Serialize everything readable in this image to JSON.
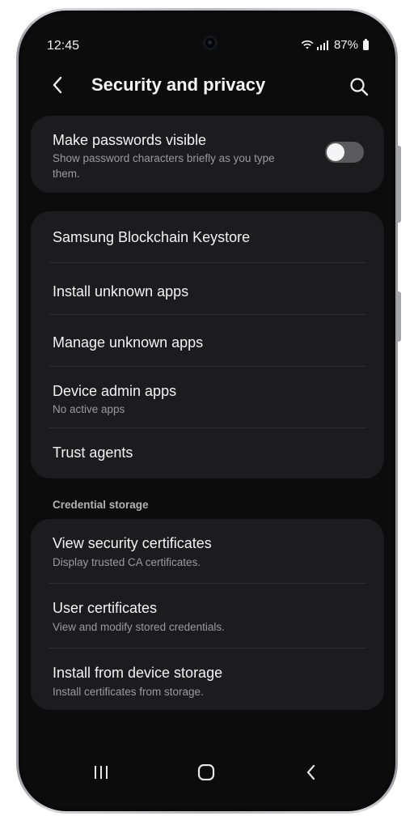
{
  "status_bar": {
    "time": "12:45",
    "battery": "87%",
    "icons": [
      "wifi-icon",
      "signal-icon",
      "battery-icon"
    ]
  },
  "header": {
    "back_icon": "chevron-left-icon",
    "title": "Security and privacy",
    "search_icon": "search-icon"
  },
  "password_card": {
    "title": "Make passwords visible",
    "subtitle": "Show password characters briefly as you type them.",
    "toggle_on": false
  },
  "apps_card": {
    "items": [
      {
        "title": "Samsung Blockchain Keystore",
        "subtitle": ""
      },
      {
        "title": "Install unknown apps",
        "subtitle": ""
      },
      {
        "title": "Manage unknown apps",
        "subtitle": ""
      },
      {
        "title": "Device admin apps",
        "subtitle": "No active apps"
      },
      {
        "title": "Trust agents",
        "subtitle": ""
      }
    ]
  },
  "credential_section": {
    "header": "Credential storage",
    "items": [
      {
        "title": "View security certificates",
        "subtitle": "Display trusted CA certificates."
      },
      {
        "title": "User certificates",
        "subtitle": "View and modify stored credentials."
      },
      {
        "title": "Install from device storage",
        "subtitle": "Install certificates from storage."
      }
    ]
  },
  "nav_bar": {
    "icons": [
      "recents-icon",
      "home-icon",
      "back-icon"
    ]
  },
  "colors": {
    "background": "#0c0c0d",
    "card": "#1c1c1e",
    "text_primary": "#f3f3f3",
    "text_secondary": "#9b9b9e",
    "toggle_off": "#5a5a5e"
  }
}
